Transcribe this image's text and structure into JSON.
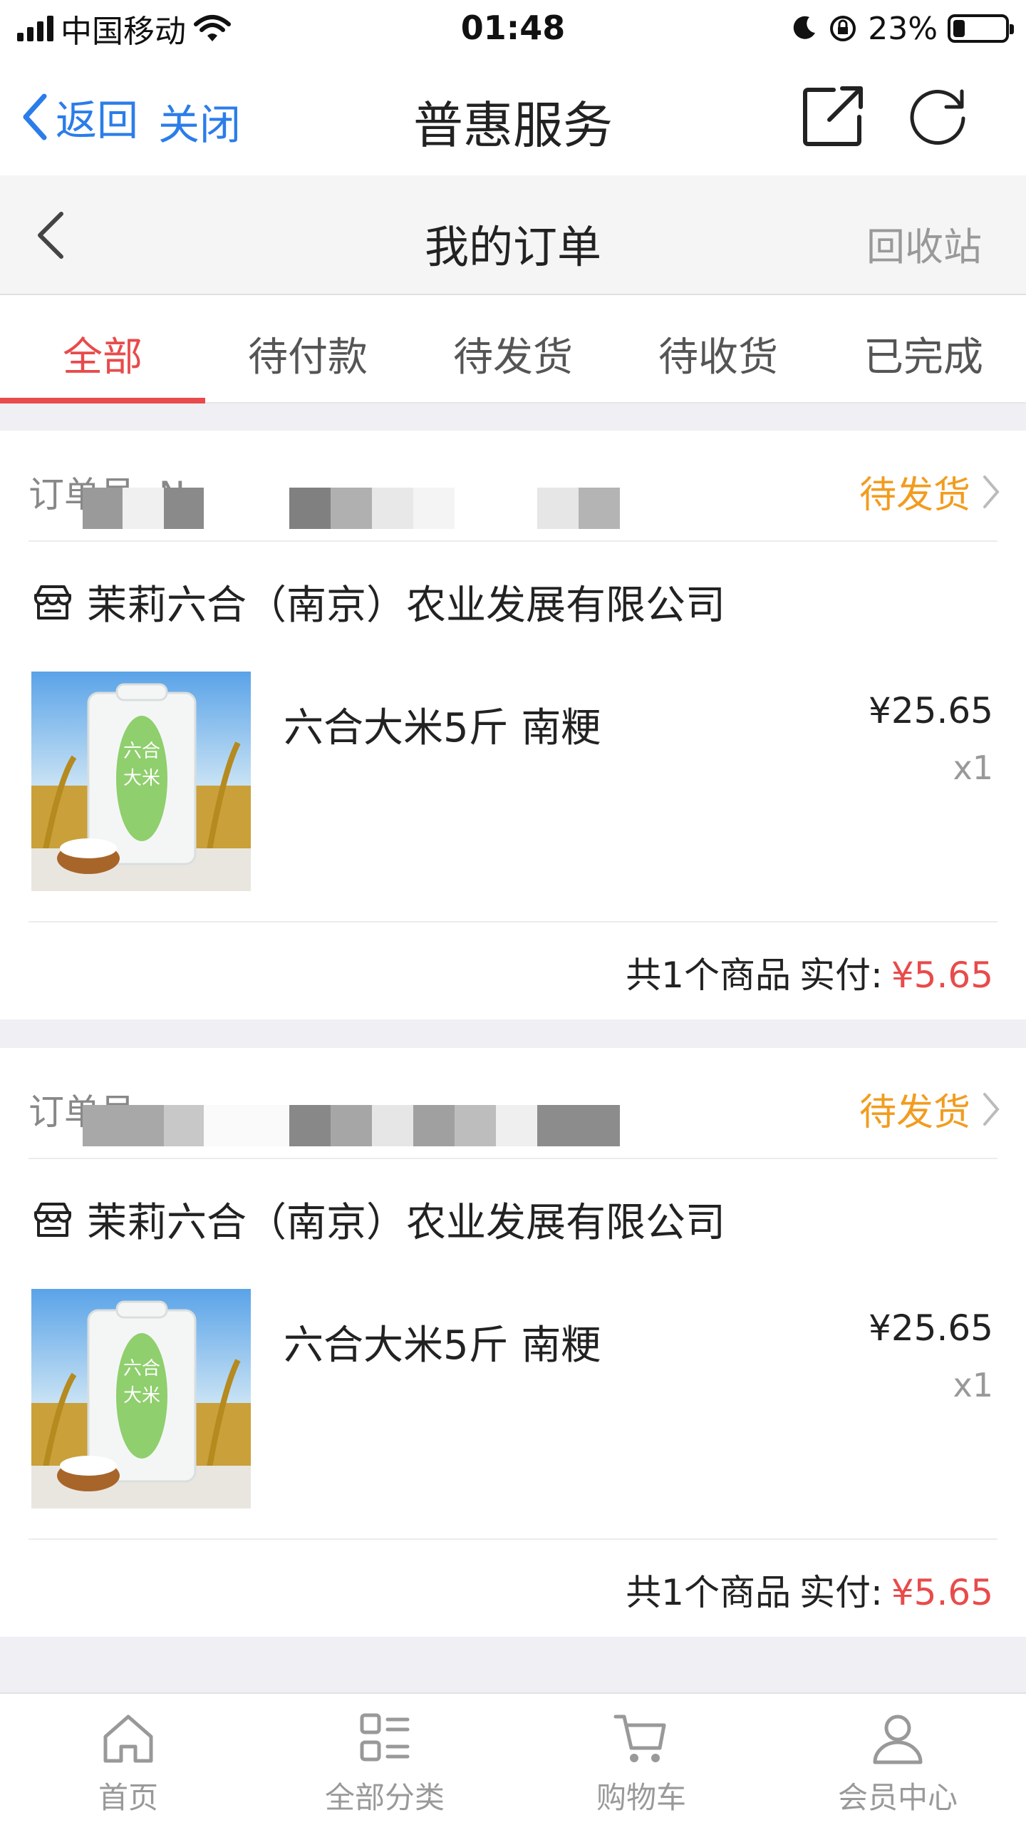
{
  "status_bar": {
    "carrier": "中国移动",
    "time": "01:48",
    "battery": "23%",
    "battery_level": 0.23
  },
  "browser_nav": {
    "back_label": "返回",
    "close_label": "关闭",
    "title": "普惠服务",
    "icons": [
      "share-icon",
      "reload-icon"
    ]
  },
  "page_header": {
    "title": "我的订单",
    "recycle_label": "回收站"
  },
  "tabs": [
    {
      "label": "全部",
      "active": true
    },
    {
      "label": "待付款",
      "active": false
    },
    {
      "label": "待发货",
      "active": false
    },
    {
      "label": "待收货",
      "active": false
    },
    {
      "label": "已完成",
      "active": false
    }
  ],
  "orders": [
    {
      "order_no_label": "订单号: N",
      "status": "待发货",
      "shop": "茉莉六合（南京）农业发展有限公司",
      "product_name": "六合大米5斤 南粳",
      "price": "¥25.65",
      "qty": "x1",
      "summary": "共1个商品",
      "pay_label": "实付:",
      "pay_amount": "¥5.65"
    },
    {
      "order_no_label": "订单号",
      "status": "待发货",
      "shop": "茉莉六合（南京）农业发展有限公司",
      "product_name": "六合大米5斤 南粳",
      "price": "¥25.65",
      "qty": "x1",
      "summary": "共1个商品",
      "pay_label": "实付:",
      "pay_amount": "¥5.65"
    }
  ],
  "tabbar": [
    {
      "label": "首页",
      "icon": "home-icon"
    },
    {
      "label": "全部分类",
      "icon": "category-icon"
    },
    {
      "label": "购物车",
      "icon": "cart-icon"
    },
    {
      "label": "会员中心",
      "icon": "user-icon"
    }
  ],
  "colors": {
    "accent": "#e84b4b",
    "status": "#f29c1f",
    "link": "#2b7de9"
  }
}
